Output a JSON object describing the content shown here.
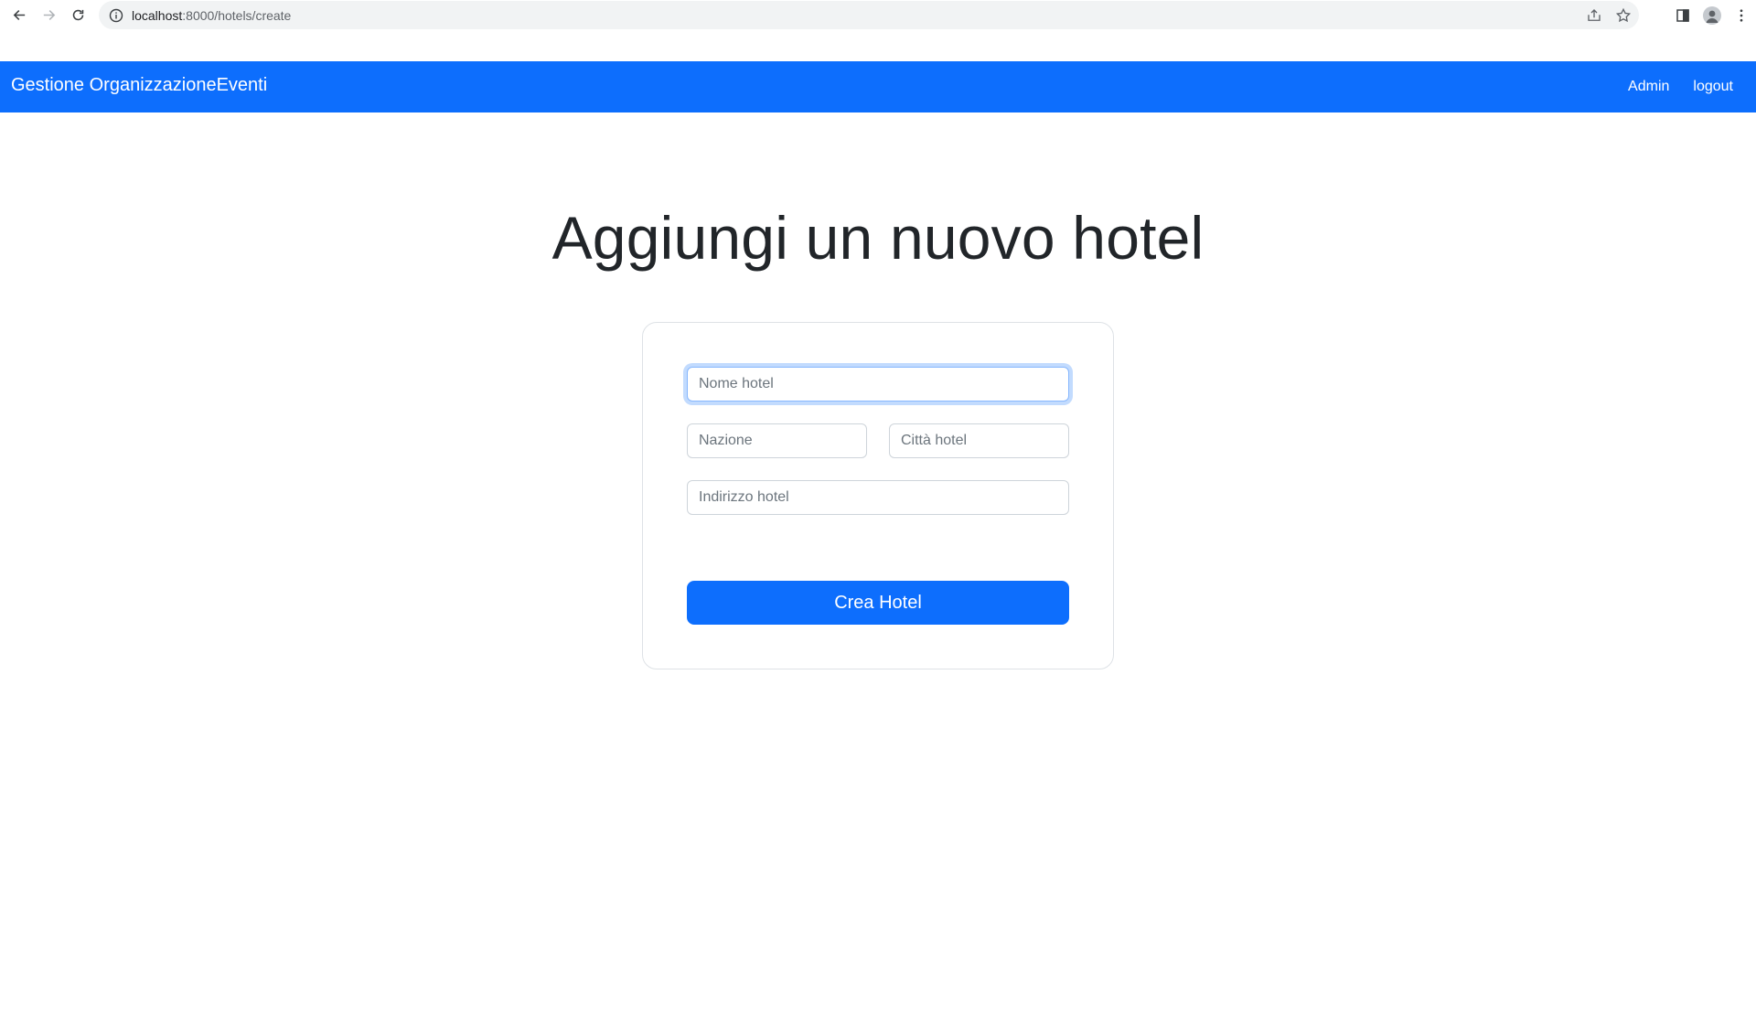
{
  "browser": {
    "url_host": "localhost",
    "url_path": ":8000/hotels/create"
  },
  "navbar": {
    "brand": "Gestione OrganizzazioneEventi",
    "links": [
      "Admin",
      "logout"
    ],
    "bg_color": "#0d6efd"
  },
  "page": {
    "title": "Aggiungi un nuovo hotel"
  },
  "form": {
    "name_placeholder": "Nome hotel",
    "country_placeholder": "Nazione",
    "city_placeholder": "Città hotel",
    "address_placeholder": "Indirizzo hotel",
    "submit_label": "Crea Hotel"
  }
}
